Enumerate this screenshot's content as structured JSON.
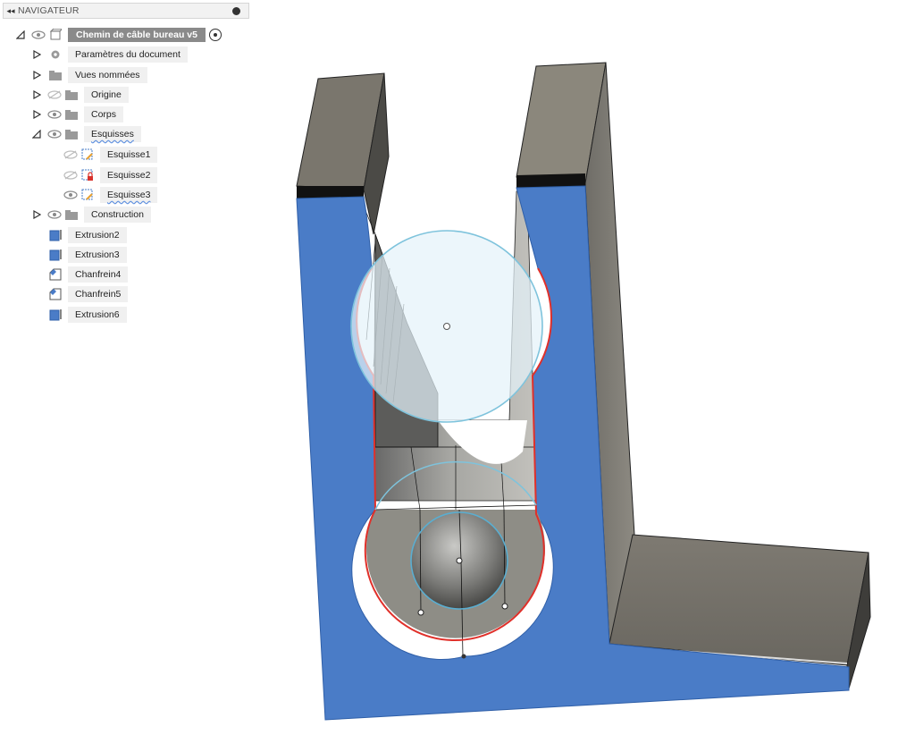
{
  "navigator": {
    "title": "NAVIGATEUR",
    "root_label": "Chemin de câble bureau v5",
    "items": [
      {
        "label": "Paramètres du document"
      },
      {
        "label": "Vues nommées"
      },
      {
        "label": "Origine"
      },
      {
        "label": "Corps"
      },
      {
        "label": "Esquisses"
      },
      {
        "label": "Esquisse1"
      },
      {
        "label": "Esquisse2"
      },
      {
        "label": "Esquisse3"
      },
      {
        "label": "Construction"
      }
    ],
    "timeline": [
      {
        "label": "Extrusion2",
        "icon": "extrude-icon"
      },
      {
        "label": "Extrusion3",
        "icon": "extrude-icon"
      },
      {
        "label": "Chanfrein4",
        "icon": "chamfer-icon"
      },
      {
        "label": "Chanfrein5",
        "icon": "chamfer-icon"
      },
      {
        "label": "Extrusion6",
        "icon": "extrude-icon"
      }
    ]
  },
  "colors": {
    "face_blue": "#4a7cc7",
    "body_grey": "#8c887e",
    "sketch_cyan": "#7ec3dc",
    "selection_red": "#e0302a"
  }
}
